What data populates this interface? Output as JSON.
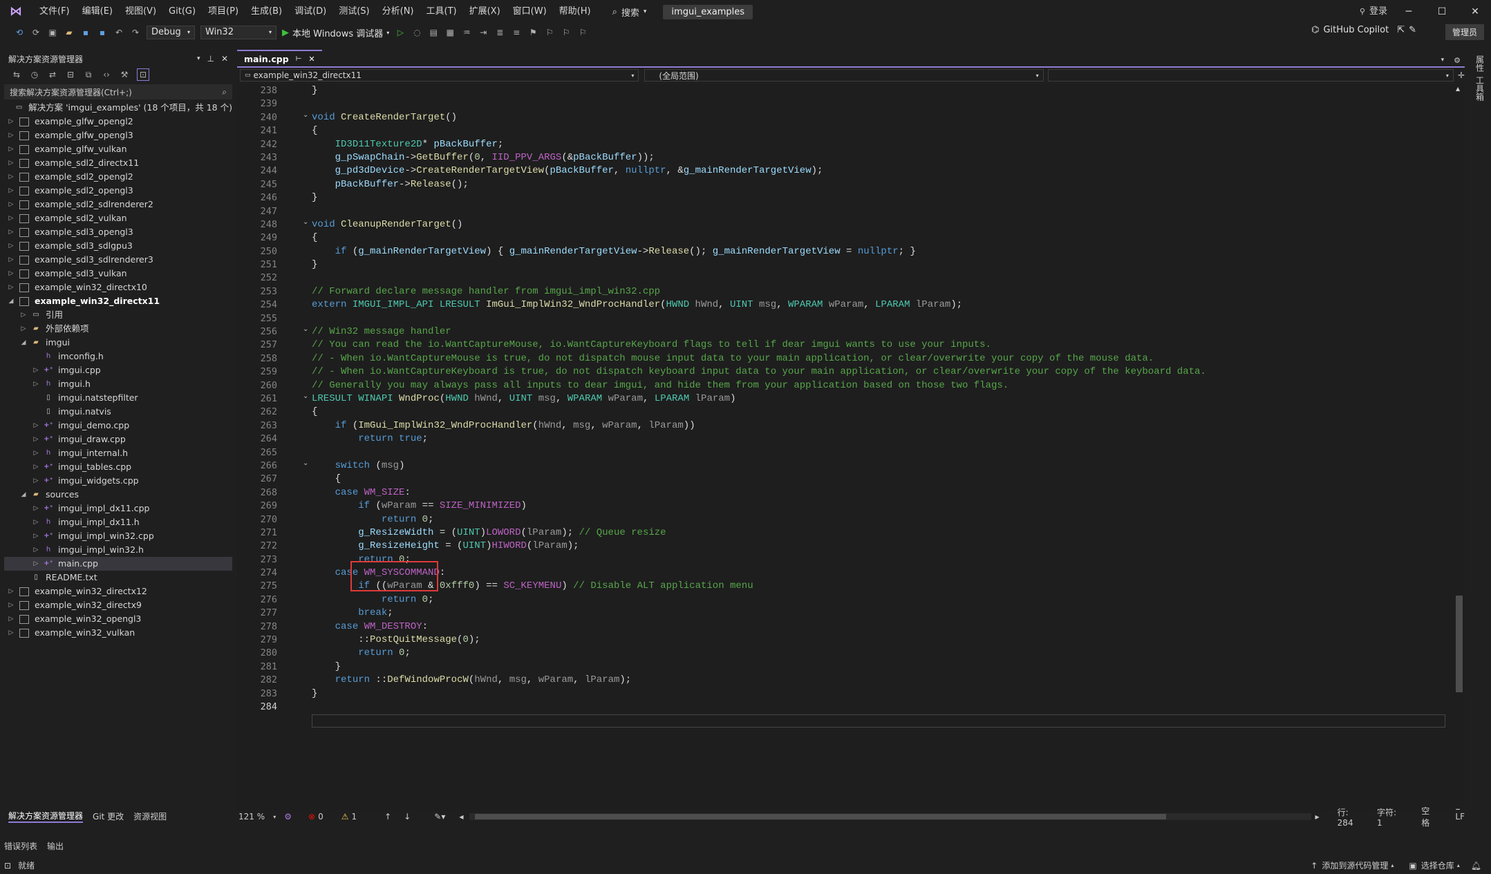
{
  "menu": {
    "items": [
      "文件(F)",
      "编辑(E)",
      "视图(V)",
      "Git(G)",
      "项目(P)",
      "生成(B)",
      "调试(D)",
      "测试(S)",
      "分析(N)",
      "工具(T)",
      "扩展(X)",
      "窗口(W)",
      "帮助(H)"
    ],
    "search": "搜索",
    "solution_name": "imgui_examples",
    "login": "登录"
  },
  "toolbar": {
    "config": "Debug",
    "platform": "Win32",
    "run_label": "本地 Windows 调试器",
    "copilot": "GitHub Copilot",
    "admin": "管理员"
  },
  "solution_explorer": {
    "title": "解决方案资源管理器",
    "search_placeholder": "搜索解决方案资源管理器(Ctrl+;)",
    "root": "解决方案 'imgui_examples' (18 个项目，共 18 个)",
    "tabs": [
      "解决方案资源管理器",
      "Git 更改",
      "资源视图"
    ],
    "nodes": [
      {
        "label": "example_glfw_opengl2",
        "depth": 0,
        "kind": "proj",
        "arrow": "▷"
      },
      {
        "label": "example_glfw_opengl3",
        "depth": 0,
        "kind": "proj",
        "arrow": "▷"
      },
      {
        "label": "example_glfw_vulkan",
        "depth": 0,
        "kind": "proj",
        "arrow": "▷"
      },
      {
        "label": "example_sdl2_directx11",
        "depth": 0,
        "kind": "proj",
        "arrow": "▷"
      },
      {
        "label": "example_sdl2_opengl2",
        "depth": 0,
        "kind": "proj",
        "arrow": "▷"
      },
      {
        "label": "example_sdl2_opengl3",
        "depth": 0,
        "kind": "proj",
        "arrow": "▷"
      },
      {
        "label": "example_sdl2_sdlrenderer2",
        "depth": 0,
        "kind": "proj",
        "arrow": "▷"
      },
      {
        "label": "example_sdl2_vulkan",
        "depth": 0,
        "kind": "proj",
        "arrow": "▷"
      },
      {
        "label": "example_sdl3_opengl3",
        "depth": 0,
        "kind": "proj",
        "arrow": "▷"
      },
      {
        "label": "example_sdl3_sdlgpu3",
        "depth": 0,
        "kind": "proj",
        "arrow": "▷"
      },
      {
        "label": "example_sdl3_sdlrenderer3",
        "depth": 0,
        "kind": "proj",
        "arrow": "▷"
      },
      {
        "label": "example_sdl3_vulkan",
        "depth": 0,
        "kind": "proj",
        "arrow": "▷"
      },
      {
        "label": "example_win32_directx10",
        "depth": 0,
        "kind": "proj",
        "arrow": "▷"
      },
      {
        "label": "example_win32_directx11",
        "depth": 0,
        "kind": "proj",
        "arrow": "◢",
        "bold": true
      },
      {
        "label": "引用",
        "depth": 1,
        "kind": "ref",
        "arrow": "▷"
      },
      {
        "label": "外部依赖项",
        "depth": 1,
        "kind": "folder",
        "arrow": "▷"
      },
      {
        "label": "imgui",
        "depth": 1,
        "kind": "folder",
        "arrow": "◢"
      },
      {
        "label": "imconfig.h",
        "depth": 2,
        "kind": "h",
        "arrow": ""
      },
      {
        "label": "imgui.cpp",
        "depth": 2,
        "kind": "cpp",
        "arrow": "▷"
      },
      {
        "label": "imgui.h",
        "depth": 2,
        "kind": "h",
        "arrow": "▷"
      },
      {
        "label": "imgui.natstepfilter",
        "depth": 2,
        "kind": "file",
        "arrow": ""
      },
      {
        "label": "imgui.natvis",
        "depth": 2,
        "kind": "file",
        "arrow": ""
      },
      {
        "label": "imgui_demo.cpp",
        "depth": 2,
        "kind": "cpp",
        "arrow": "▷"
      },
      {
        "label": "imgui_draw.cpp",
        "depth": 2,
        "kind": "cpp",
        "arrow": "▷"
      },
      {
        "label": "imgui_internal.h",
        "depth": 2,
        "kind": "h",
        "arrow": "▷"
      },
      {
        "label": "imgui_tables.cpp",
        "depth": 2,
        "kind": "cpp",
        "arrow": "▷"
      },
      {
        "label": "imgui_widgets.cpp",
        "depth": 2,
        "kind": "cpp",
        "arrow": "▷"
      },
      {
        "label": "sources",
        "depth": 1,
        "kind": "folder",
        "arrow": "◢"
      },
      {
        "label": "imgui_impl_dx11.cpp",
        "depth": 2,
        "kind": "cpp",
        "arrow": "▷"
      },
      {
        "label": "imgui_impl_dx11.h",
        "depth": 2,
        "kind": "h",
        "arrow": "▷"
      },
      {
        "label": "imgui_impl_win32.cpp",
        "depth": 2,
        "kind": "cpp",
        "arrow": "▷"
      },
      {
        "label": "imgui_impl_win32.h",
        "depth": 2,
        "kind": "h",
        "arrow": "▷"
      },
      {
        "label": "main.cpp",
        "depth": 2,
        "kind": "cpp",
        "arrow": "▷",
        "selected": true
      },
      {
        "label": "README.txt",
        "depth": 1,
        "kind": "file",
        "arrow": ""
      },
      {
        "label": "example_win32_directx12",
        "depth": 0,
        "kind": "proj",
        "arrow": "▷"
      },
      {
        "label": "example_win32_directx9",
        "depth": 0,
        "kind": "proj",
        "arrow": "▷"
      },
      {
        "label": "example_win32_opengl3",
        "depth": 0,
        "kind": "proj",
        "arrow": "▷"
      },
      {
        "label": "example_win32_vulkan",
        "depth": 0,
        "kind": "proj",
        "arrow": "▷"
      }
    ]
  },
  "editor": {
    "tab": "main.cpp",
    "nav_project": "example_win32_directx11",
    "nav_scope": "(全局范围)",
    "lines": [
      {
        "n": 238,
        "t": "}"
      },
      {
        "n": 239,
        "t": ""
      },
      {
        "n": 240,
        "t": "void CreateRenderTarget()",
        "fold": true
      },
      {
        "n": 241,
        "t": "{"
      },
      {
        "n": 242,
        "t": "    ID3D11Texture2D* pBackBuffer;"
      },
      {
        "n": 243,
        "t": "    g_pSwapChain->GetBuffer(0, IID_PPV_ARGS(&pBackBuffer));"
      },
      {
        "n": 244,
        "t": "    g_pd3dDevice->CreateRenderTargetView(pBackBuffer, nullptr, &g_mainRenderTargetView);"
      },
      {
        "n": 245,
        "t": "    pBackBuffer->Release();"
      },
      {
        "n": 246,
        "t": "}"
      },
      {
        "n": 247,
        "t": ""
      },
      {
        "n": 248,
        "t": "void CleanupRenderTarget()",
        "fold": true
      },
      {
        "n": 249,
        "t": "{"
      },
      {
        "n": 250,
        "t": "    if (g_mainRenderTargetView) { g_mainRenderTargetView->Release(); g_mainRenderTargetView = nullptr; }"
      },
      {
        "n": 251,
        "t": "}"
      },
      {
        "n": 252,
        "t": ""
      },
      {
        "n": 253,
        "t": "// Forward declare message handler from imgui_impl_win32.cpp"
      },
      {
        "n": 254,
        "t": "extern IMGUI_IMPL_API LRESULT ImGui_ImplWin32_WndProcHandler(HWND hWnd, UINT msg, WPARAM wParam, LPARAM lParam);"
      },
      {
        "n": 255,
        "t": ""
      },
      {
        "n": 256,
        "t": "// Win32 message handler",
        "fold": true
      },
      {
        "n": 257,
        "t": "// You can read the io.WantCaptureMouse, io.WantCaptureKeyboard flags to tell if dear imgui wants to use your inputs."
      },
      {
        "n": 258,
        "t": "// - When io.WantCaptureMouse is true, do not dispatch mouse input data to your main application, or clear/overwrite your copy of the mouse data."
      },
      {
        "n": 259,
        "t": "// - When io.WantCaptureKeyboard is true, do not dispatch keyboard input data to your main application, or clear/overwrite your copy of the keyboard data."
      },
      {
        "n": 260,
        "t": "// Generally you may always pass all inputs to dear imgui, and hide them from your application based on those two flags."
      },
      {
        "n": 261,
        "t": "LRESULT WINAPI WndProc(HWND hWnd, UINT msg, WPARAM wParam, LPARAM lParam)",
        "fold": true
      },
      {
        "n": 262,
        "t": "{"
      },
      {
        "n": 263,
        "t": "    if (ImGui_ImplWin32_WndProcHandler(hWnd, msg, wParam, lParam))"
      },
      {
        "n": 264,
        "t": "        return true;"
      },
      {
        "n": 265,
        "t": ""
      },
      {
        "n": 266,
        "t": "    switch (msg)",
        "fold": true
      },
      {
        "n": 267,
        "t": "    {"
      },
      {
        "n": 268,
        "t": "    case WM_SIZE:"
      },
      {
        "n": 269,
        "t": "        if (wParam == SIZE_MINIMIZED)"
      },
      {
        "n": 270,
        "t": "            return 0;"
      },
      {
        "n": 271,
        "t": "        g_ResizeWidth = (UINT)LOWORD(lParam); // Queue resize"
      },
      {
        "n": 272,
        "t": "        g_ResizeHeight = (UINT)HIWORD(lParam);"
      },
      {
        "n": 273,
        "t": "        return 0;"
      },
      {
        "n": 274,
        "t": "    case WM_SYSCOMMAND:"
      },
      {
        "n": 275,
        "t": "        if ((wParam & 0xfff0) == SC_KEYMENU) // Disable ALT application menu"
      },
      {
        "n": 276,
        "t": "            return 0;"
      },
      {
        "n": 277,
        "t": "        break;"
      },
      {
        "n": 278,
        "t": "    case WM_DESTROY:"
      },
      {
        "n": 279,
        "t": "        ::PostQuitMessage(0);"
      },
      {
        "n": 280,
        "t": "        return 0;"
      },
      {
        "n": 281,
        "t": "    }"
      },
      {
        "n": 282,
        "t": "    return ::DefWindowProcW(hWnd, msg, wParam, lParam);"
      },
      {
        "n": 283,
        "t": "}"
      },
      {
        "n": 284,
        "t": ""
      }
    ],
    "zoom": "121 %",
    "errors": "0",
    "warnings": "1",
    "line_label": "行: 284",
    "char_label": "字符: 1",
    "whitespace": "空格",
    "eol": "LF"
  },
  "bottom": {
    "tabs": [
      "错误列表",
      "输出"
    ]
  },
  "statusbar": {
    "ready": "就绪",
    "source_control": "添加到源代码管理",
    "repo": "选择仓库"
  },
  "right_rail": [
    "属性",
    "工具箱"
  ]
}
